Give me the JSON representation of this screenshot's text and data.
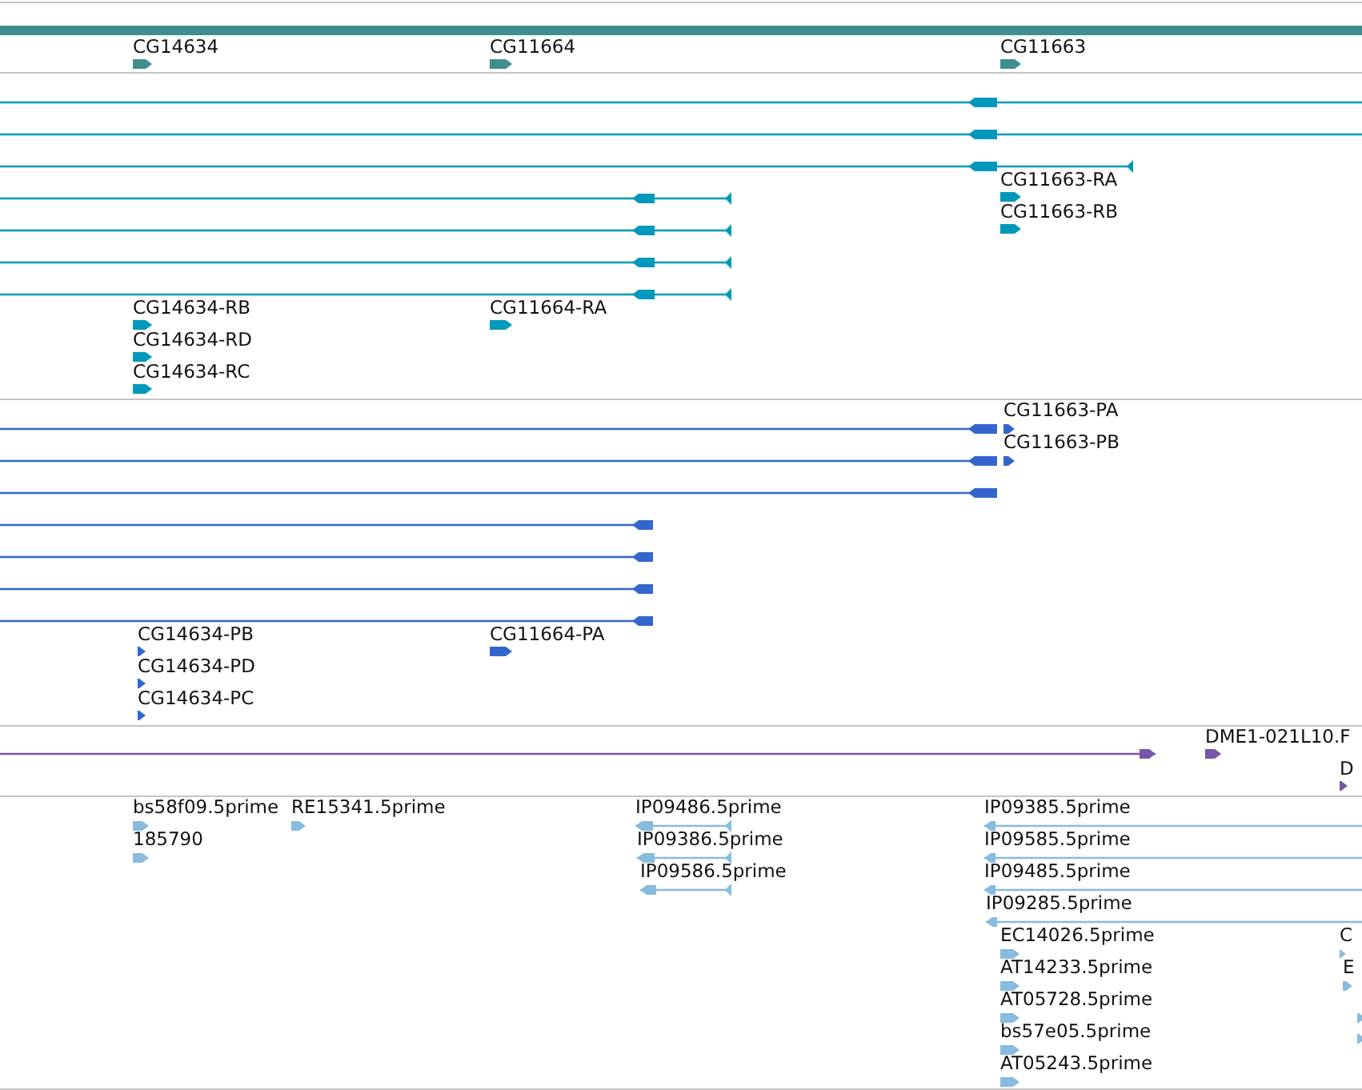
{
  "tracks": [
    {
      "color": "#3f8f8f",
      "features": [
        {
          "label": "CG14634",
          "reverse": false
        },
        {
          "label": "CG11664",
          "reverse": false
        },
        {
          "label": "CG11663",
          "reverse": false
        }
      ]
    },
    {
      "color": "#0099bb",
      "features": [
        {
          "reverse": true
        },
        {
          "reverse": true
        },
        {
          "reverse": true
        },
        {
          "reverse": true
        },
        {
          "reverse": true
        },
        {
          "reverse": true
        },
        {
          "reverse": true
        },
        {
          "label": "CG11663-RA",
          "reverse": false
        },
        {
          "label": "CG11663-RB",
          "reverse": false
        },
        {
          "label": "CG14634-RB",
          "reverse": false
        },
        {
          "label": "CG14634-RD",
          "reverse": false
        },
        {
          "label": "CG14634-RC",
          "reverse": false
        },
        {
          "label": "CG11664-RA",
          "reverse": false
        }
      ]
    },
    {
      "color": "#3366cc",
      "features": [
        {
          "reverse": true
        },
        {
          "reverse": true
        },
        {
          "reverse": true
        },
        {
          "reverse": true
        },
        {
          "reverse": true
        },
        {
          "reverse": true
        },
        {
          "reverse": true
        },
        {
          "label": "CG11663-PA",
          "reverse": false
        },
        {
          "label": "CG11663-PB",
          "reverse": false
        },
        {
          "label": "CG14634-PB",
          "reverse": false
        },
        {
          "label": "CG14634-PD",
          "reverse": false
        },
        {
          "label": "CG14634-PC",
          "reverse": false
        },
        {
          "label": "CG11664-PA",
          "reverse": false
        }
      ]
    },
    {
      "color": "#7755aa",
      "features": [
        {
          "reverse": false
        },
        {
          "label": "DME1-021L10.F",
          "reverse": false
        },
        {
          "label": "D",
          "reverse": false
        }
      ]
    },
    {
      "color": "#88bbdd",
      "features": [
        {
          "label": "bs58f09.5prime",
          "reverse": false
        },
        {
          "label": "RE15341.5prime",
          "reverse": false
        },
        {
          "label": "185790",
          "reverse": false
        },
        {
          "label": "IP09486.5prime",
          "reverse": true
        },
        {
          "label": "IP09386.5prime",
          "reverse": true
        },
        {
          "label": "IP09586.5prime",
          "reverse": true
        },
        {
          "label": "IP09385.5prime",
          "reverse": true
        },
        {
          "label": "IP09585.5prime",
          "reverse": true
        },
        {
          "label": "IP09485.5prime",
          "reverse": true
        },
        {
          "label": "IP09285.5prime",
          "reverse": true
        },
        {
          "label": "EC14026.5prime",
          "reverse": false
        },
        {
          "label": "AT14233.5prime",
          "reverse": false
        },
        {
          "label": "AT05728.5prime",
          "reverse": false
        },
        {
          "label": "bs57e05.5prime",
          "reverse": false
        },
        {
          "label": "AT05243.5prime",
          "reverse": false
        },
        {
          "label": "C",
          "reverse": false
        },
        {
          "label": "E",
          "reverse": false
        },
        {
          "reverse": false
        },
        {
          "reverse": false
        }
      ]
    }
  ]
}
